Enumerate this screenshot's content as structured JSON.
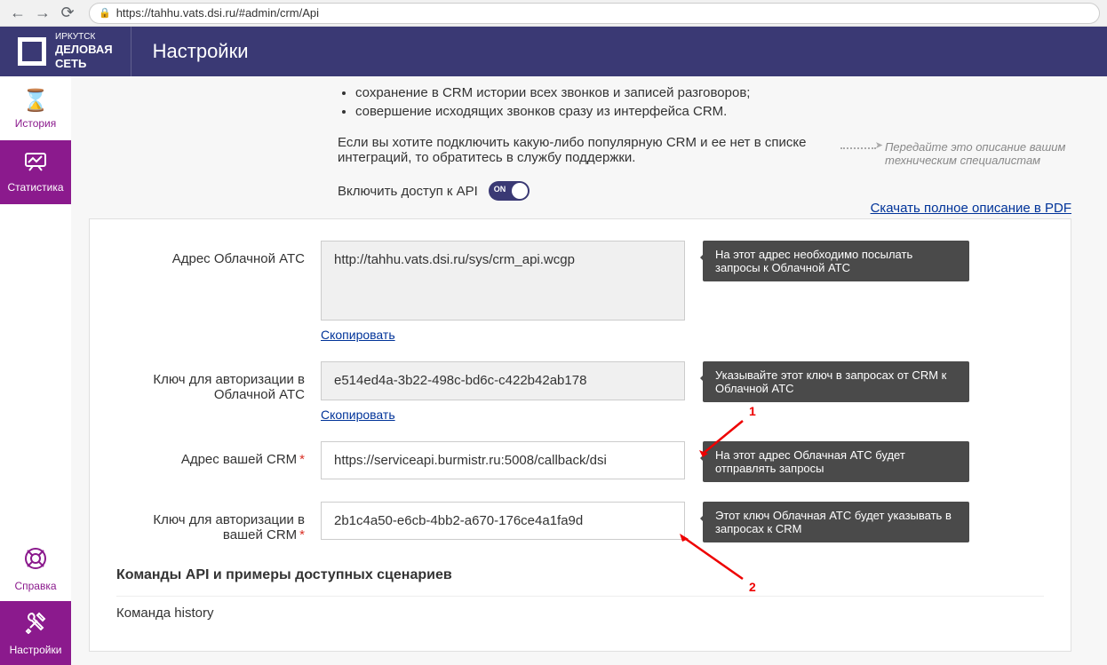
{
  "browser": {
    "url": "https://tahhu.vats.dsi.ru/#admin/crm/Api"
  },
  "header": {
    "logo_line1": "ИРКУТСК",
    "logo_line2": "ДЕЛОВАЯ",
    "logo_line3": "СЕТЬ",
    "title": "Настройки"
  },
  "sidebar": {
    "history": "История",
    "stats": "Статистика",
    "help": "Справка",
    "settings": "Настройки"
  },
  "intro": {
    "bullets": [
      "сохранение в CRM истории всех звонков и записей разговоров;",
      "совершение исходящих звонков сразу из интерфейса CRM."
    ],
    "paragraph": "Если вы хотите подключить какую-либо популярную CRM и ее нет в списке интеграций, то обратитесь в службу поддержки.",
    "toggle_label": "Включить доступ к API",
    "toggle_state": "ON",
    "side_note": "Передайте это описание вашим техническим специалистам",
    "pdf_link": "Скачать полное описание в PDF"
  },
  "form": {
    "rows": [
      {
        "label": "Адрес Облачной АТС",
        "value": "http://tahhu.vats.dsi.ru/sys/crm_api.wcgp",
        "tip": "На этот адрес необходимо посылать запросы к Облачной АТС",
        "readonly": true,
        "tall": true,
        "copy": "Скопировать"
      },
      {
        "label": "Ключ для авторизации в Облачной АТС",
        "value": "e514ed4a-3b22-498c-bd6c-c422b42ab178",
        "tip": "Указывайте этот ключ в запросах от CRM к Облачной АТС",
        "readonly": true,
        "copy": "Скопировать"
      },
      {
        "label": "Адрес вашей CRM",
        "required": true,
        "value": "https://serviceapi.burmistr.ru:5008/callback/dsi",
        "tip": "На этот адрес Облачная АТС будет отправлять запросы",
        "readonly": false
      },
      {
        "label": "Ключ для авторизации в вашей CRM",
        "required": true,
        "value": "2b1c4a50-e6cb-4bb2-a670-176ce4a1fa9d",
        "tip": "Этот ключ Облачная АТС будет указывать в запросах к CRM",
        "readonly": false
      }
    ],
    "section_heading": "Команды API и примеры доступных сценариев",
    "command_prefix": "Команда ",
    "command_name": "history"
  },
  "annotations": {
    "num1": "1",
    "num2": "2"
  }
}
